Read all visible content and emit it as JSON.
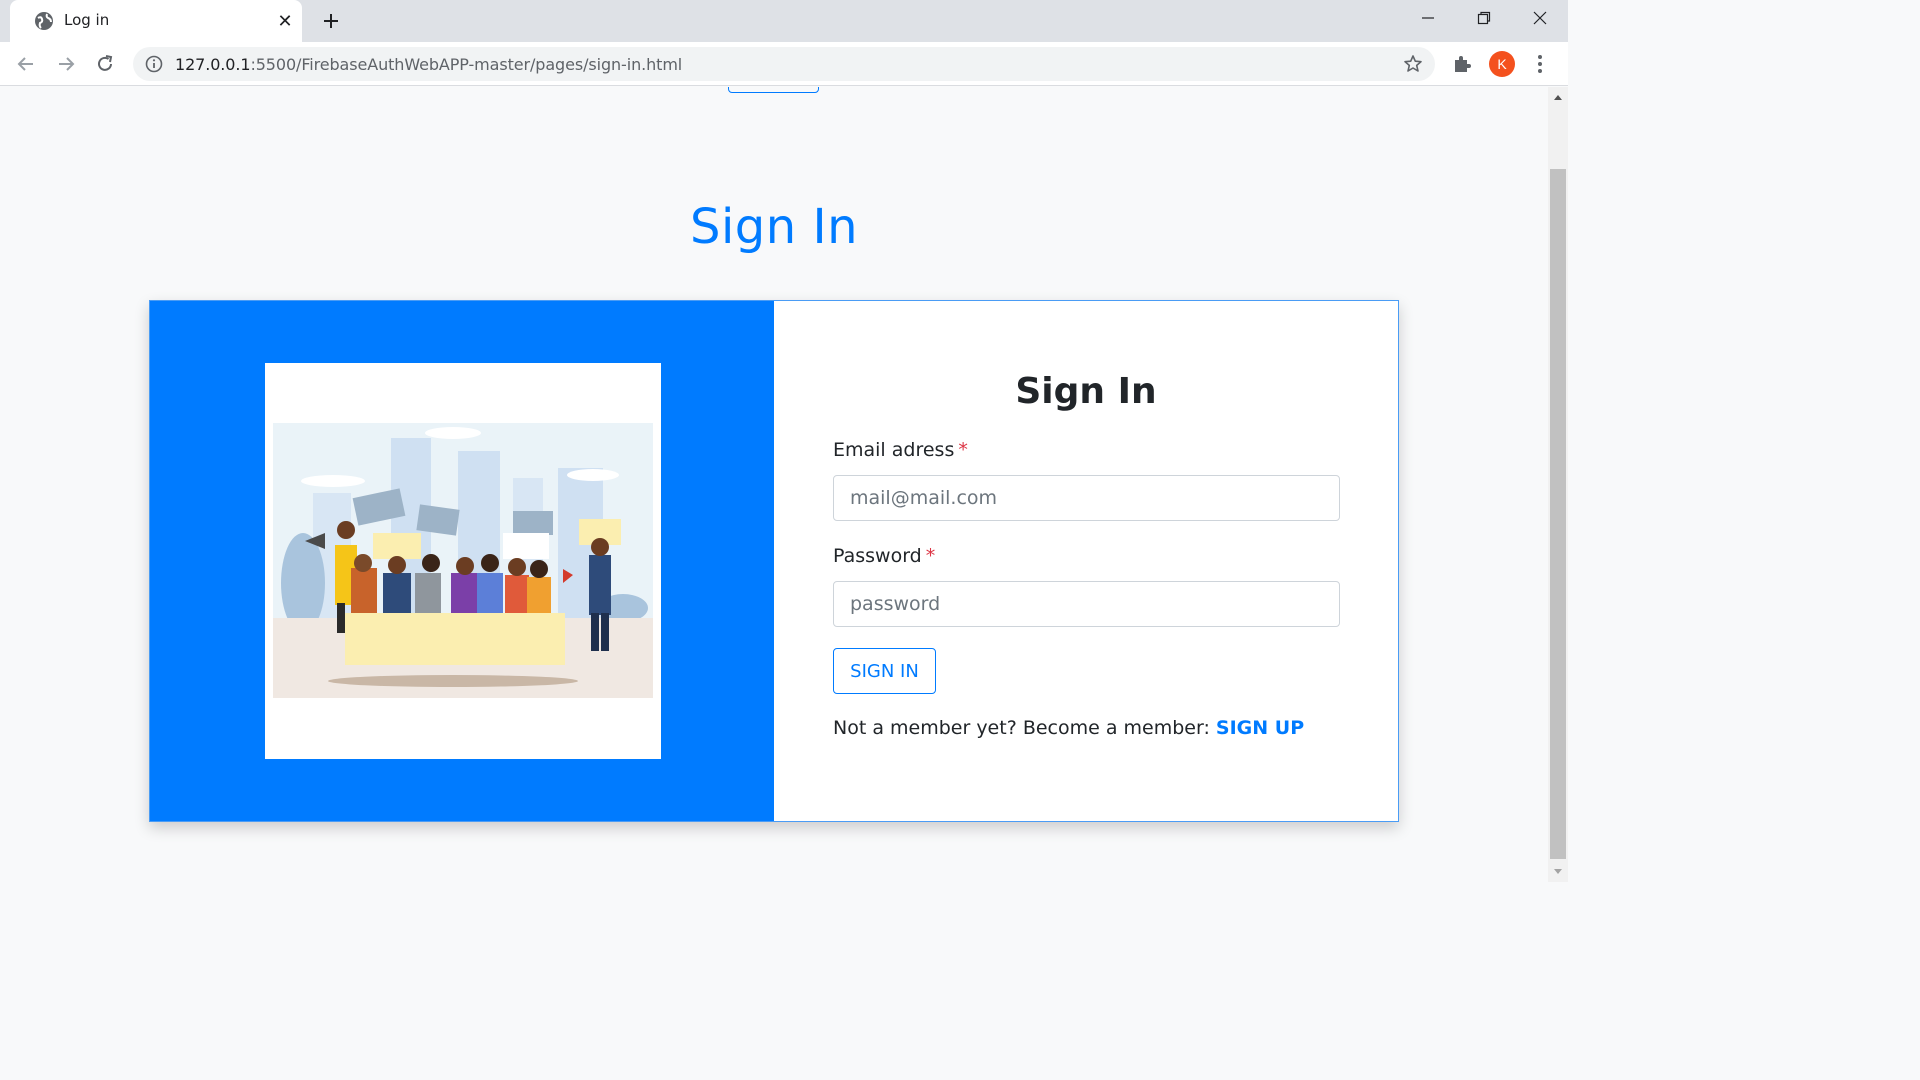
{
  "browser": {
    "tab": {
      "title": "Log in",
      "close_glyph": "✕",
      "favicon": "globe-icon"
    },
    "new_tab_glyph": "+",
    "address": {
      "host": "127.0.0.1",
      "rest": ":5500/FirebaseAuthWebAPP-master/pages/sign-in.html"
    },
    "profile_initial": "K",
    "profile_color": "#f4511e"
  },
  "page": {
    "title": "Sign In",
    "illustration": "crowd-protest-illustration"
  },
  "form": {
    "title": "Sign In",
    "email": {
      "label": "Email adress",
      "required_mark": "*",
      "placeholder": "mail@mail.com",
      "value": ""
    },
    "password": {
      "label": "Password",
      "required_mark": "*",
      "placeholder": "password",
      "value": ""
    },
    "submit_label": "SIGN IN",
    "member_prompt": "Not a member yet? Become a member:",
    "signup_link": "SIGN UP"
  },
  "colors": {
    "accent": "#007bff",
    "required": "#dc3545",
    "text": "#212529"
  }
}
